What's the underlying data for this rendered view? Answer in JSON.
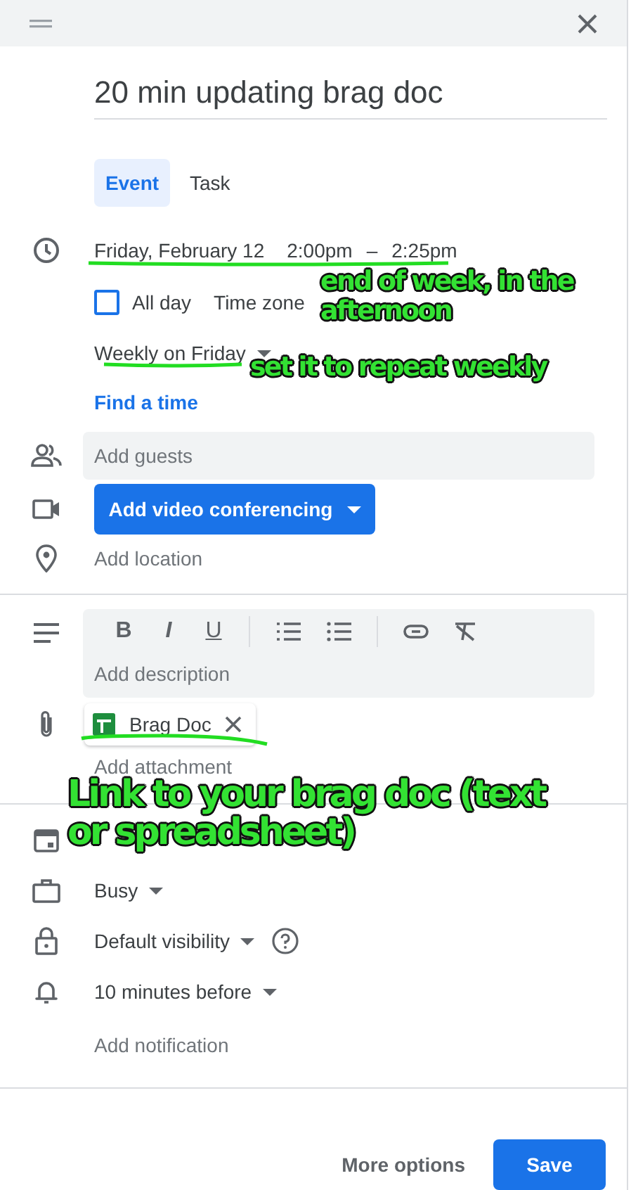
{
  "title": "20 min updating brag doc",
  "tabs": [
    {
      "label": "Event",
      "selected": true
    },
    {
      "label": "Task",
      "selected": false
    }
  ],
  "when": {
    "date": "Friday, February 12",
    "start": "2:00pm",
    "separator": "–",
    "end": "2:25pm"
  },
  "all_day": {
    "label": "All day",
    "checked": false
  },
  "time_zone": "Time zone",
  "recurrence": "Weekly on Friday",
  "find_time": "Find a time",
  "guests": {
    "placeholder": "Add guests"
  },
  "video_button": "Add video conferencing",
  "location": {
    "placeholder": "Add location"
  },
  "description": {
    "toolbar": [
      "B",
      "I",
      "U"
    ],
    "placeholder": "Add description"
  },
  "attachment": {
    "label": "Brag Doc"
  },
  "add_attachment": "Add attachment",
  "availability": "Busy",
  "visibility": "Default visibility",
  "notification": "10 minutes before",
  "add_notification": "Add notification",
  "footer": {
    "more_options": "More options",
    "save": "Save"
  },
  "annotations": [
    {
      "text": "end of week, in the afternoon"
    },
    {
      "text": "set it to repeat weekly"
    },
    {
      "text": "Link to your brag doc (text or spreadsheet)"
    }
  ]
}
